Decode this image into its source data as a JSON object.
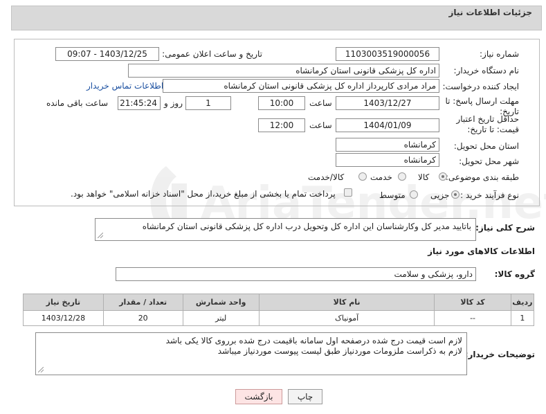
{
  "page_title": "جزئیات اطلاعات نیاز",
  "fields": {
    "need_number_label": "شماره نیاز:",
    "need_number": "1103003519000056",
    "announce_label": "تاریخ و ساعت اعلان عمومی:",
    "announce_value": "1403/12/25 - 09:07",
    "buyer_label": "نام دستگاه خریدار:",
    "buyer": "اداره کل پزشکی قانونی استان کرمانشاه",
    "creator_label": "ایجاد کننده درخواست:",
    "creator": "مراد مرادی کارپرداز اداره کل پزشکی قانونی استان کرمانشاه",
    "contact_link": "اطلاعات تماس خریدار",
    "deadline_label": "مهلت ارسال پاسخ: تا تاریخ:",
    "deadline_date": "1403/12/27",
    "time_label": "ساعت",
    "deadline_time": "10:00",
    "days_value": "1",
    "days_label": "روز و",
    "remaining_time": "21:45:24",
    "remaining_label": "ساعت باقی مانده",
    "validity_label": "حداقل تاریخ اعتبار قیمت: تا تاریخ:",
    "validity_date": "1404/01/09",
    "validity_time": "12:00",
    "province_label": "استان محل تحویل:",
    "province": "کرمانشاه",
    "city_label": "شهر محل تحویل:",
    "city": "کرمانشاه",
    "category_label": "طبقه بندی موضوعی:",
    "category_options": [
      "کالا",
      "خدمت",
      "کالا/خدمت"
    ],
    "process_label": "نوع فرآیند خرید :",
    "process_options": [
      "جزیی",
      "متوسط"
    ],
    "payment_note": "پرداخت تمام یا بخشی از مبلغ خرید،از محل \"اسناد خزانه اسلامی\" خواهد بود."
  },
  "description": {
    "label": "شرح کلی نیاز:",
    "text": "باتایید مدیر کل وکارشناسان این اداره کل  وتحویل درب اداره کل پزشکی قانونی استان کرمانشاه"
  },
  "goods": {
    "section_title": "اطلاعات کالاهای مورد نیاز",
    "group_label": "گروه کالا:",
    "group_value": "دارو، پزشکی و سلامت",
    "columns": [
      "ردیف",
      "کد کالا",
      "نام کالا",
      "واحد شمارش",
      "تعداد / مقدار",
      "تاریخ نیاز"
    ],
    "rows": [
      {
        "index": "1",
        "code": "--",
        "name": "آمونیاک",
        "unit": "لیتر",
        "qty": "20",
        "date": "1403/12/28"
      }
    ]
  },
  "buyer_notes": {
    "label": "توضیحات خریدار:",
    "line1": "لازم است قیمت درج شده درصفحه اول سامانه باقیمت درج شده برروی کالا یکی باشد",
    "line2": "لازم به ذکراست ملزومات موردنیاز طبق لیست پیوست موردنیاز میباشد"
  },
  "buttons": {
    "print": "چاپ",
    "back": "بازگشت"
  },
  "watermark": "AriaTender.net",
  "colors": {
    "header_bg": "#d9d9d9",
    "link": "#1a4fa0",
    "back_btn_bg": "#fde4e4"
  }
}
